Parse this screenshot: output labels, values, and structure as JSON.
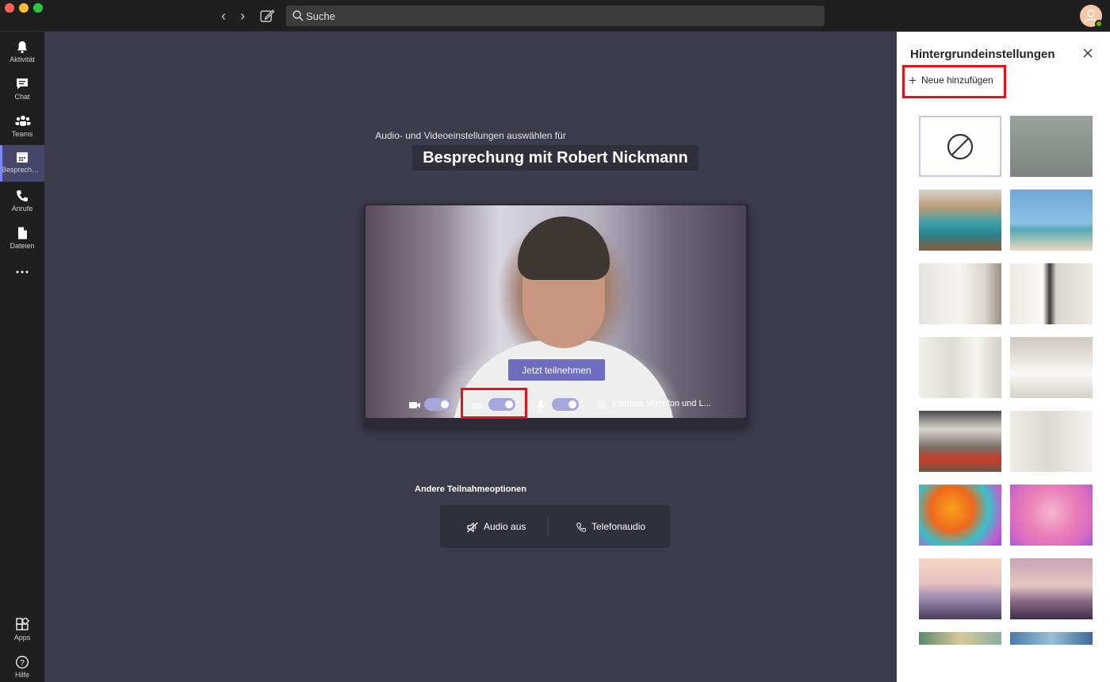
{
  "window": {
    "search_placeholder": "Suche"
  },
  "rail": {
    "items": [
      {
        "label": "Aktivität",
        "icon": "bell-icon"
      },
      {
        "label": "Chat",
        "icon": "chat-icon"
      },
      {
        "label": "Teams",
        "icon": "teams-icon"
      },
      {
        "label": "Besprechun...",
        "icon": "calendar-icon",
        "active": true
      },
      {
        "label": "Anrufe",
        "icon": "phone-icon"
      },
      {
        "label": "Dateien",
        "icon": "file-icon"
      },
      {
        "label": "",
        "icon": "more-icon"
      },
      {
        "label": "Apps",
        "icon": "apps-icon"
      },
      {
        "label": "Hilfe",
        "icon": "help-icon"
      }
    ]
  },
  "prejoin": {
    "subtitle": "Audio- und Videoeinstellungen auswählen für",
    "title": "Besprechung mit Robert Nickmann",
    "join_label": "Jetzt teilnehmen",
    "device_label": "Internes Mikrofon und L...",
    "camera_on": true,
    "background_blur_on": true,
    "mic_on": true
  },
  "other_options": {
    "label": "Andere Teilnahmeoptionen",
    "audio_off": "Audio aus",
    "phone_audio": "Telefonaudio"
  },
  "background_panel": {
    "title": "Hintergrundeinstellungen",
    "add_new": "Neue hinzufügen",
    "thumbnails": [
      "none",
      "blur",
      "office-lockers",
      "beach-lifeguard",
      "white-room-1",
      "white-room-2",
      "white-loft",
      "white-studio",
      "office-lounge",
      "white-window",
      "balloons-orange",
      "balloons-pink",
      "bridge-illustration",
      "rock-arch-illustration",
      "city-illustration-1",
      "city-illustration-2"
    ]
  },
  "colors": {
    "accent": "#6f6dc2",
    "highlight": "#e8101a",
    "toggle_on": "#a6a7dc"
  }
}
